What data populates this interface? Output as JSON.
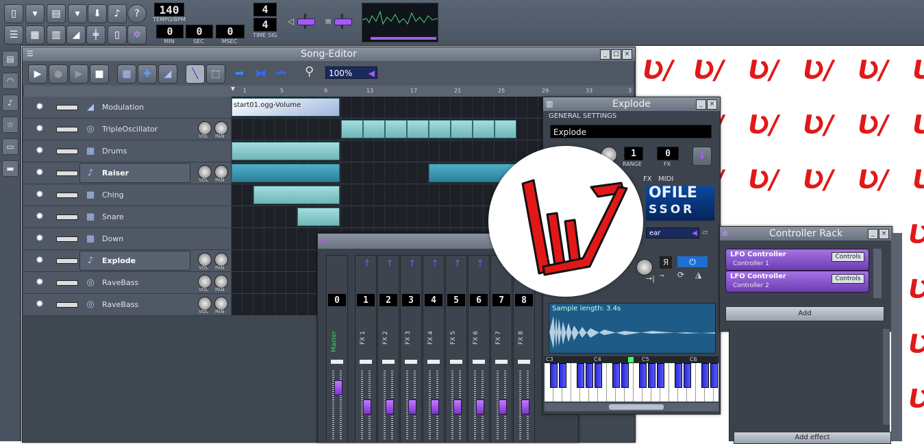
{
  "toolbar": {
    "tempo_value": "140",
    "tempo_label": "TEMPO/BPM",
    "time_min": "0",
    "time_sec": "0",
    "time_msec": "0",
    "min_label": "MIN",
    "sec_label": "SEC",
    "msec_label": "MSEC",
    "timesig_num": "4",
    "timesig_den": "4",
    "timesig_label": "TIME SIG"
  },
  "song_editor": {
    "title": "Song-Editor",
    "zoom": "100%",
    "ruler": [
      "1",
      "5",
      "9",
      "13",
      "17",
      "21",
      "25",
      "29",
      "33",
      "3"
    ],
    "tracks": [
      {
        "name": "Modulation",
        "clip": "start01.ogg-Volume"
      },
      {
        "name": "TripleOscillator",
        "vol": "VOL",
        "pan": "PAN"
      },
      {
        "name": "Drums"
      },
      {
        "name": "Raiser",
        "vol": "VOL",
        "pan": "PAN"
      },
      {
        "name": "Ching"
      },
      {
        "name": "Snare"
      },
      {
        "name": "Down"
      },
      {
        "name": "Explode",
        "vol": "VOL",
        "pan": "PAN"
      },
      {
        "name": "RaveBass",
        "vol": "VOL",
        "pan": "PAN"
      },
      {
        "name": "RaveBass",
        "vol": "VOL",
        "pan": "PAN"
      }
    ]
  },
  "mixer": {
    "channels": [
      {
        "num": "0",
        "label": "Master"
      },
      {
        "num": "1",
        "label": "FX 1"
      },
      {
        "num": "2",
        "label": "FX 2"
      },
      {
        "num": "3",
        "label": "FX 3"
      },
      {
        "num": "4",
        "label": "FX 4"
      },
      {
        "num": "5",
        "label": "FX 5"
      },
      {
        "num": "6",
        "label": "FX 6"
      },
      {
        "num": "7",
        "label": "FX 7"
      },
      {
        "num": "8",
        "label": "FX 8"
      }
    ]
  },
  "explode": {
    "title": "Explode",
    "general_settings": "GENERAL SETTINGS",
    "name_value": "Explode",
    "range_label": "RANGE",
    "fx_label": "FX",
    "fx_value": "0",
    "tabs": [
      "FX",
      "MIDI"
    ],
    "plugin_text_1": "OFILE",
    "plugin_text_2": "SSOR",
    "interp_value": "ear",
    "sample_length": "Sample length: 3.4s",
    "keys": [
      "C3",
      "C4",
      "C5",
      "C6"
    ]
  },
  "controller_rack": {
    "title": "Controller Rack",
    "controllers": [
      {
        "name": "LFO Controller",
        "sub": "Controller 1",
        "button": "Controls"
      },
      {
        "name": "LFO Controller",
        "sub": "Controller 2",
        "button": "Controls"
      }
    ],
    "add_label": "Add"
  },
  "effects": {
    "add_effect_label": "Add effect"
  },
  "colors": {
    "accent": "#e21818",
    "clip": "#8fcfd0",
    "fader": "#a35cf0"
  }
}
